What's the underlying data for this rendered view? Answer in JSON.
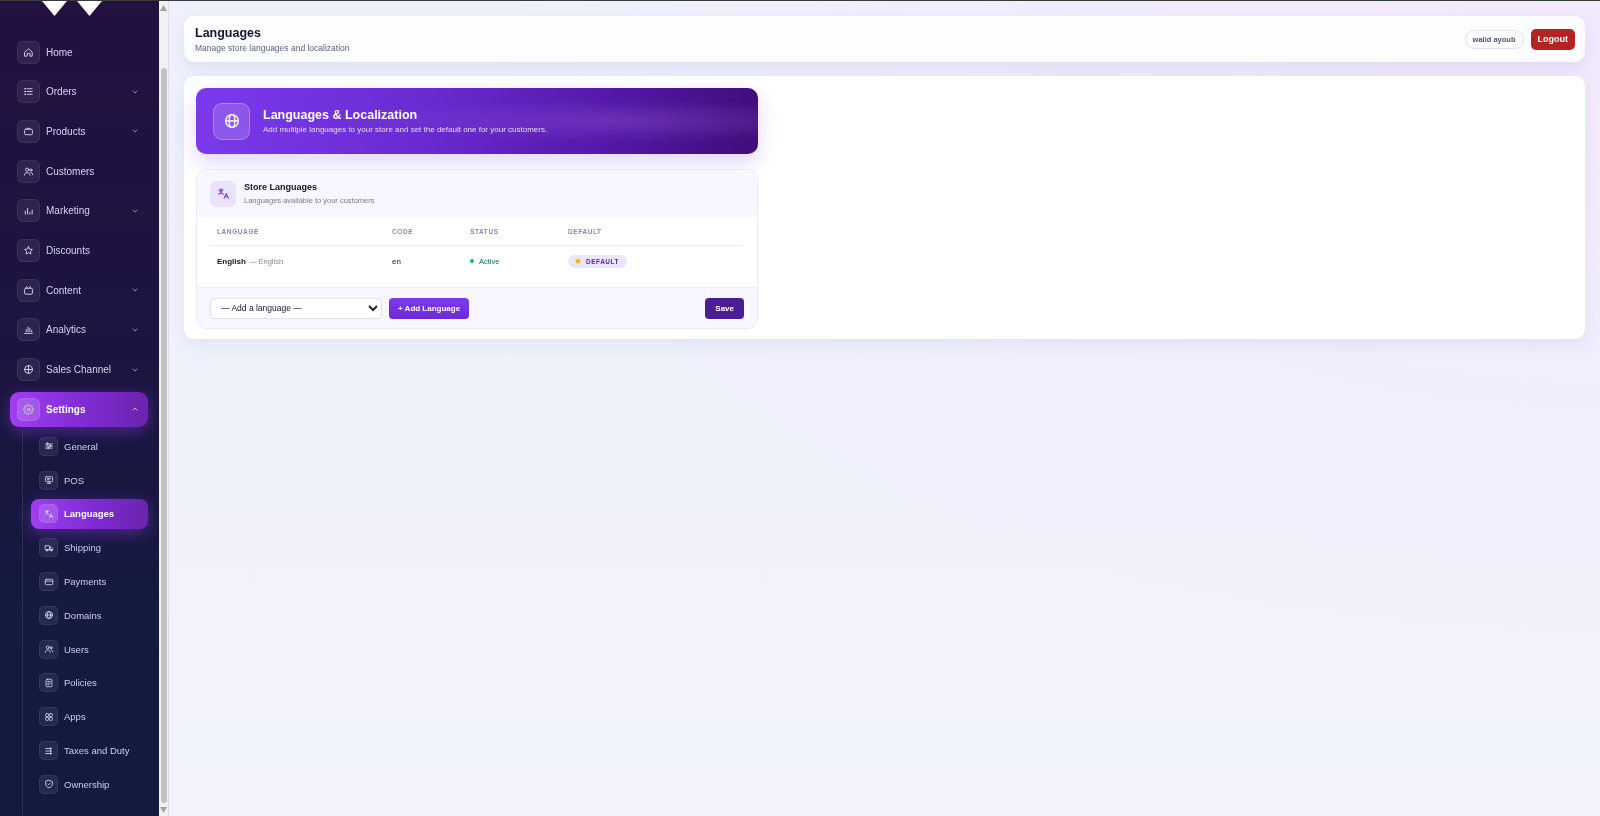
{
  "sidebar": {
    "items": [
      {
        "label": "Home",
        "kind": "link",
        "selected": false
      },
      {
        "label": "Orders",
        "kind": "group",
        "expanded": false,
        "selected": false
      },
      {
        "label": "Products",
        "kind": "group",
        "expanded": false,
        "selected": false
      },
      {
        "label": "Customers",
        "kind": "link",
        "selected": false
      },
      {
        "label": "Marketing",
        "kind": "group",
        "expanded": false,
        "selected": false
      },
      {
        "label": "Discounts",
        "kind": "link",
        "selected": false
      },
      {
        "label": "Content",
        "kind": "group",
        "expanded": false,
        "selected": false
      },
      {
        "label": "Analytics",
        "kind": "group",
        "expanded": false,
        "selected": false
      },
      {
        "label": "Sales Channel",
        "kind": "group",
        "expanded": false,
        "selected": false
      },
      {
        "label": "Settings",
        "kind": "group",
        "expanded": true,
        "selected": true,
        "children": [
          {
            "label": "General",
            "selected": false
          },
          {
            "label": "POS",
            "selected": false
          },
          {
            "label": "Languages",
            "selected": true
          },
          {
            "label": "Shipping",
            "selected": false
          },
          {
            "label": "Payments",
            "selected": false
          },
          {
            "label": "Domains",
            "selected": false
          },
          {
            "label": "Users",
            "selected": false
          },
          {
            "label": "Policies",
            "selected": false
          },
          {
            "label": "Apps",
            "selected": false
          },
          {
            "label": "Taxes and Duty",
            "selected": false
          },
          {
            "label": "Ownership",
            "selected": false
          }
        ]
      }
    ]
  },
  "header": {
    "title": "Languages",
    "subtitle": "Manage store languages and localization",
    "user": "walid ayoub",
    "logout": "Logout"
  },
  "banner": {
    "title": "Languages & Localization",
    "subtitle": "Add multiple languages to your store and set the default one for your customers."
  },
  "store_languages": {
    "title": "Store Languages",
    "subtitle": "Languages available to your customers",
    "table": {
      "columns": [
        "LANGUAGE",
        "CODE",
        "STATUS",
        "DEFAULT"
      ],
      "rows": [
        {
          "language": "English",
          "native": "— English",
          "code": "en",
          "status": "Active",
          "active": true,
          "default": true,
          "default_badge": "DEFAULT"
        }
      ]
    },
    "language_select": {
      "value": "— Add a language —"
    },
    "add_button": "+ Add Language",
    "save_button": "Save"
  }
}
